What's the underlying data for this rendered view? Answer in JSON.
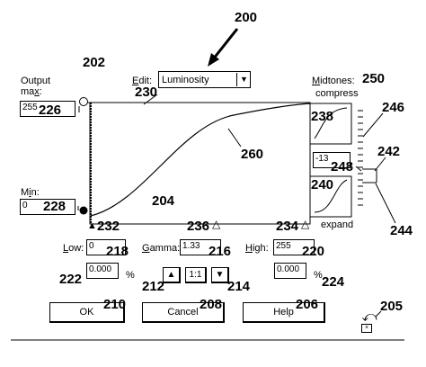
{
  "figure_ref": "200",
  "dialog_ref": "202",
  "edit": {
    "label": "Edit:",
    "value": "Luminosity",
    "ref": "230"
  },
  "output": {
    "label_line1": "Output",
    "label_line2": "max:",
    "max_value": "255",
    "max_ref": "226",
    "min_label": "Min:",
    "min_value": "0",
    "min_ref": "228"
  },
  "graph": {
    "area_ref": "204",
    "curve_ref": "260"
  },
  "markers": {
    "left": {
      "glyph": "▲",
      "ref": "232"
    },
    "middle": {
      "ref": "236",
      "glyph": "△"
    },
    "right": {
      "ref": "234",
      "glyph": "△"
    }
  },
  "midtones": {
    "label": "Midtones:",
    "ref": "250",
    "compress_label": "compress",
    "expand_label": "expand",
    "top_thumb_ref": "238",
    "value": "-13",
    "value_ref": "248",
    "bottom_thumb_ref": "240",
    "slider_ref": "246",
    "handle_ref": "242",
    "bracket_ref": "244"
  },
  "levels": {
    "low_label": "Low:",
    "low_value": "0",
    "low_ref": "218",
    "gamma_label": "Gamma:",
    "gamma_value": "1.33",
    "gamma_ref": "216",
    "high_label": "High:",
    "high_value": "255",
    "high_ref": "220"
  },
  "percent": {
    "left_value": "0.000",
    "left_symbol": "%",
    "left_ref": "222",
    "right_value": "0.000",
    "right_symbol": "%",
    "right_ref": "224"
  },
  "gamma_buttons": {
    "up_ref": "212",
    "ratio_label": "1:1",
    "down_ref": "214"
  },
  "buttons": {
    "ok_label": "OK",
    "ok_ref": "210",
    "cancel_label": "Cancel",
    "cancel_ref": "208",
    "help_label": "Help",
    "help_ref": "206",
    "reset_ref": "205"
  }
}
